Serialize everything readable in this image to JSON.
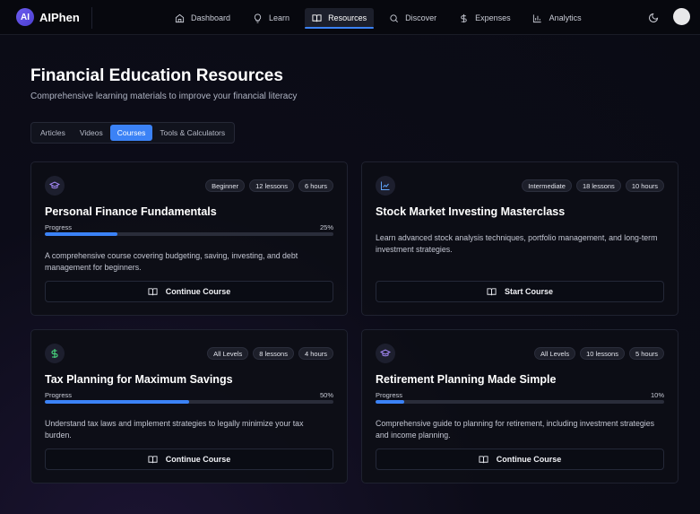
{
  "brand": {
    "logo_text": "AI",
    "name": "AIPhen"
  },
  "nav": {
    "items": [
      {
        "label": "Dashboard",
        "icon": "home-icon",
        "active": false
      },
      {
        "label": "Learn",
        "icon": "lightbulb-icon",
        "active": false
      },
      {
        "label": "Resources",
        "icon": "book-icon",
        "active": true
      },
      {
        "label": "Discover",
        "icon": "search-icon",
        "active": false
      },
      {
        "label": "Expenses",
        "icon": "dollar-icon",
        "active": false
      },
      {
        "label": "Analytics",
        "icon": "bar-chart-icon",
        "active": false
      }
    ]
  },
  "header": {
    "title": "Financial Education Resources",
    "subtitle": "Comprehensive learning materials to improve your financial literacy"
  },
  "tabs": [
    {
      "label": "Articles",
      "active": false
    },
    {
      "label": "Videos",
      "active": false
    },
    {
      "label": "Courses",
      "active": true
    },
    {
      "label": "Tools & Calculators",
      "active": false
    }
  ],
  "colors": {
    "accent": "#3b82f6",
    "icon_purple": "#a78bfa",
    "icon_green": "#4ade80",
    "icon_blue": "#60a5fa"
  },
  "courses": [
    {
      "icon": "graduation-cap-icon",
      "level": "Beginner",
      "lessons": "12 lessons",
      "duration": "6 hours",
      "title": "Personal Finance Fundamentals",
      "progress_label": "Progress",
      "progress_text": "25%",
      "progress": 25,
      "description": "A comprehensive course covering budgeting, saving, investing, and debt management for beginners.",
      "button_label": "Continue Course"
    },
    {
      "icon": "trending-up-icon",
      "level": "Intermediate",
      "lessons": "18 lessons",
      "duration": "10 hours",
      "title": "Stock Market Investing Masterclass",
      "progress_label": "",
      "progress_text": "",
      "progress": 0,
      "description": "Learn advanced stock analysis techniques, portfolio management, and long-term investment strategies.",
      "button_label": "Start Course"
    },
    {
      "icon": "dollar-icon",
      "level": "All Levels",
      "lessons": "8 lessons",
      "duration": "4 hours",
      "title": "Tax Planning for Maximum Savings",
      "progress_label": "Progress",
      "progress_text": "50%",
      "progress": 50,
      "description": "Understand tax laws and implement strategies to legally minimize your tax burden.",
      "button_label": "Continue Course"
    },
    {
      "icon": "graduation-cap-icon",
      "level": "All Levels",
      "lessons": "10 lessons",
      "duration": "5 hours",
      "title": "Retirement Planning Made Simple",
      "progress_label": "Progress",
      "progress_text": "10%",
      "progress": 10,
      "description": "Comprehensive guide to planning for retirement, including investment strategies and income planning.",
      "button_label": "Continue Course"
    }
  ]
}
